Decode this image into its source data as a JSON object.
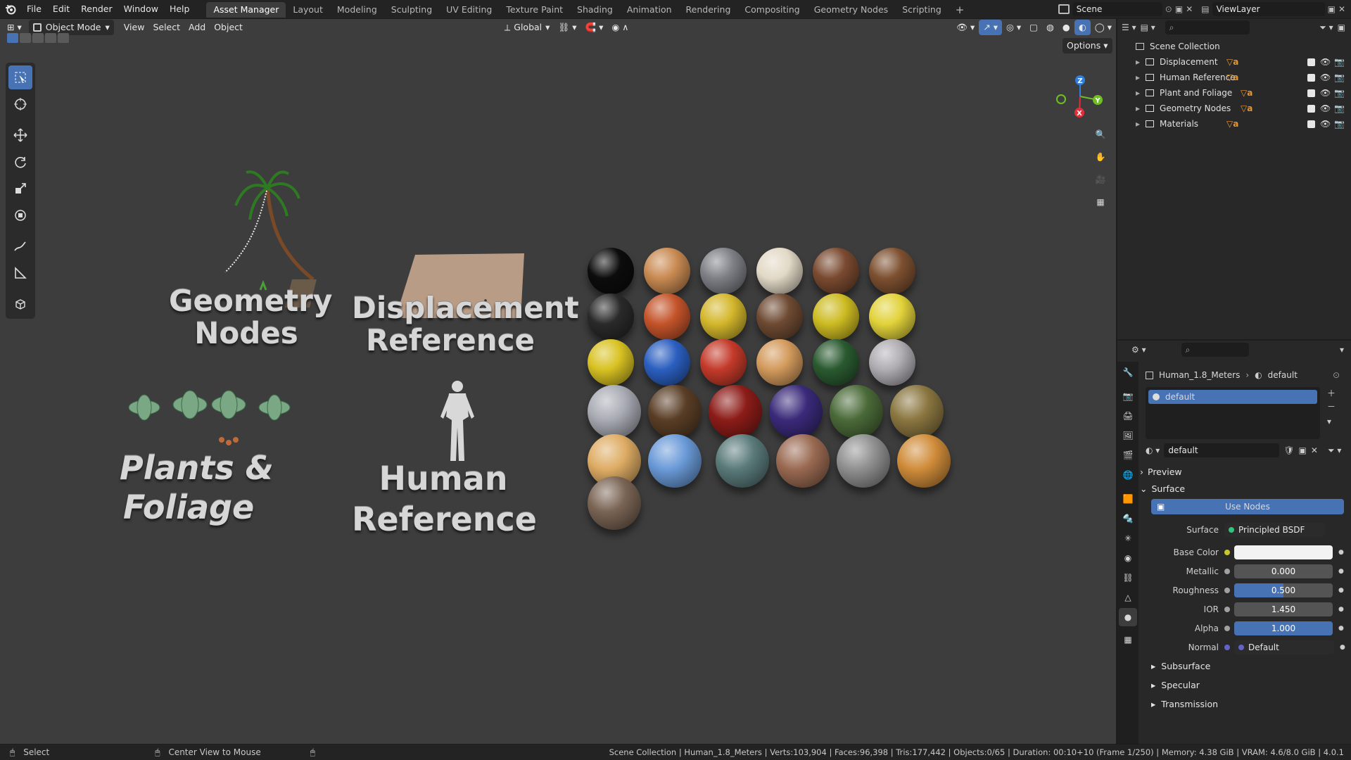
{
  "topbar": {
    "menus": [
      "File",
      "Edit",
      "Render",
      "Window",
      "Help"
    ],
    "workspaces": [
      "Asset Manager",
      "Layout",
      "Modeling",
      "Sculpting",
      "UV Editing",
      "Texture Paint",
      "Shading",
      "Animation",
      "Rendering",
      "Compositing",
      "Geometry Nodes",
      "Scripting"
    ],
    "add_tab": "+",
    "scene": "Scene",
    "view_layer": "ViewLayer"
  },
  "viewport": {
    "mode": "Object Mode",
    "menus": [
      "View",
      "Select",
      "Add",
      "Object"
    ],
    "transform_orientation": "Global",
    "options": "Options",
    "axes": {
      "z": "Z",
      "y": "Y",
      "x": "X"
    },
    "labels": {
      "geometry_nodes": [
        "Geometry",
        "Nodes"
      ],
      "displacement": [
        "Displacement",
        "Reference"
      ],
      "plants": [
        "Plants &",
        "Foliage"
      ],
      "human": [
        "Human",
        "Reference"
      ]
    },
    "materials": [
      [
        "#0c0c0c",
        "#c98a52",
        "#7e8086",
        "#e2d9c6",
        "#7a4a30",
        "#7d5030"
      ],
      [
        "#2a2a2a",
        "#c4542a",
        "#d4b72c",
        "#6e4a32",
        "#cdbb22",
        "#e2d23a"
      ],
      [
        "#d8c222",
        "#2b5fc0",
        "#c43a2a",
        "#d39a5c",
        "#2a5a30",
        "#b0adb2"
      ],
      [
        "#a9abb4",
        "#5a3e26",
        "#8c1c18",
        "#3a2a7a",
        "#4a6a38",
        "#8a7640"
      ],
      [
        "#deac64",
        "#6a9ad8",
        "#5a7a7a",
        "#9a6a52",
        "#909090",
        "#d08c3a"
      ],
      [
        "#7a6454"
      ]
    ]
  },
  "outliner": {
    "root": "Scene Collection",
    "collections": [
      "Displacement",
      "Human Reference",
      "Plant and Foliage",
      "Geometry Nodes",
      "Materials"
    ]
  },
  "properties": {
    "object": "Human_1.8_Meters",
    "material": "default",
    "slot": "default",
    "datablock": "default",
    "sections": {
      "preview": "Preview",
      "surface": "Surface"
    },
    "use_nodes": "Use Nodes",
    "surface_label": "Surface",
    "surface_shader": "Principled BSDF",
    "rows": [
      {
        "label": "Base Color",
        "value": ""
      },
      {
        "label": "Metallic",
        "value": "0.000",
        "fill": 0
      },
      {
        "label": "Roughness",
        "value": "0.500",
        "fill": 0.5
      },
      {
        "label": "IOR",
        "value": "1.450",
        "fill": 0
      },
      {
        "label": "Alpha",
        "value": "1.000",
        "fill": 1
      },
      {
        "label": "Normal",
        "value": "Default"
      }
    ],
    "subpanels": [
      "Subsurface",
      "Specular",
      "Transmission"
    ]
  },
  "statusbar": {
    "left": "Select",
    "middle": "Center View to Mouse",
    "info": "Scene Collection | Human_1.8_Meters | Verts:103,904 | Faces:96,398 | Tris:177,442 | Objects:0/65 | Duration: 00:10+10 (Frame 1/250) | Memory: 4.38 GiB | VRAM: 4.6/8.0 GiB | 4.0.1"
  },
  "colors": {
    "accent": "#4772b3",
    "header": "#232323",
    "viewport": "#3d3d3d",
    "panel": "#282828"
  }
}
